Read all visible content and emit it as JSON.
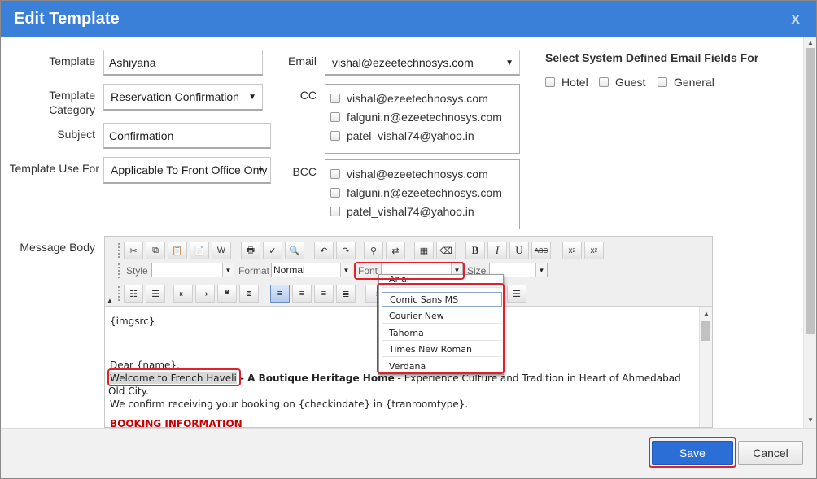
{
  "dialog": {
    "title": "Edit Template",
    "close_label": "x"
  },
  "form": {
    "template_label": "Template",
    "template_value": "Ashiyana",
    "category_label_1": "Template",
    "category_label_2": "Category",
    "category_value": "Reservation Confirmation",
    "subject_label": "Subject",
    "subject_value": "Confirmation",
    "use_for_label": "Template Use For",
    "use_for_value": "Applicable To Front Office Only",
    "email_label": "Email",
    "email_value": "vishal@ezeetechnosys.com",
    "cc_label": "CC",
    "cc_items": [
      "vishal@ezeetechnosys.com",
      "falguni.n@ezeetechnosys.com",
      "patel_vishal74@yahoo.in"
    ],
    "bcc_label": "BCC",
    "bcc_items": [
      "vishal@ezeetechnosys.com",
      "falguni.n@ezeetechnosys.com",
      "patel_vishal74@yahoo.in"
    ],
    "message_body_label": "Message Body"
  },
  "system_fields": {
    "title": "Select System Defined Email Fields For",
    "options": [
      "Hotel",
      "Guest",
      "General"
    ]
  },
  "toolbar": {
    "style_label": "Style",
    "format_label": "Format",
    "format_value": "Normal",
    "font_label": "Font",
    "size_label": "Size",
    "bold": "B",
    "italic": "I",
    "underline": "U",
    "strike": "ABC",
    "subscript": "x",
    "superscript": "x"
  },
  "font_dropdown": {
    "items": [
      "Arial",
      "Comic Sans MS",
      "Courier New",
      "Tahoma",
      "Times New Roman",
      "Verdana"
    ],
    "hovered": "Comic Sans MS"
  },
  "editor_content": {
    "img_placeholder": "{imgsrc}",
    "greeting": "Dear {name},",
    "welcome_highlight": "Welcome to French Haveli",
    "welcome_bold": " - A Boutique Heritage Home",
    "welcome_rest": " - Experience Culture and Tradition in Heart of Ahmedabad",
    "welcome_line2": "Old City.",
    "confirm_line": " We confirm receiving your booking on {checkindate} in {tranroomtype}.",
    "booking_heading": "BOOKING INFORMATION"
  },
  "footer": {
    "save_label": "Save",
    "cancel_label": "Cancel"
  },
  "colors": {
    "titlebar": "#3a7fd8",
    "save": "#2b6fd6",
    "highlight_box": "#e0202a"
  }
}
